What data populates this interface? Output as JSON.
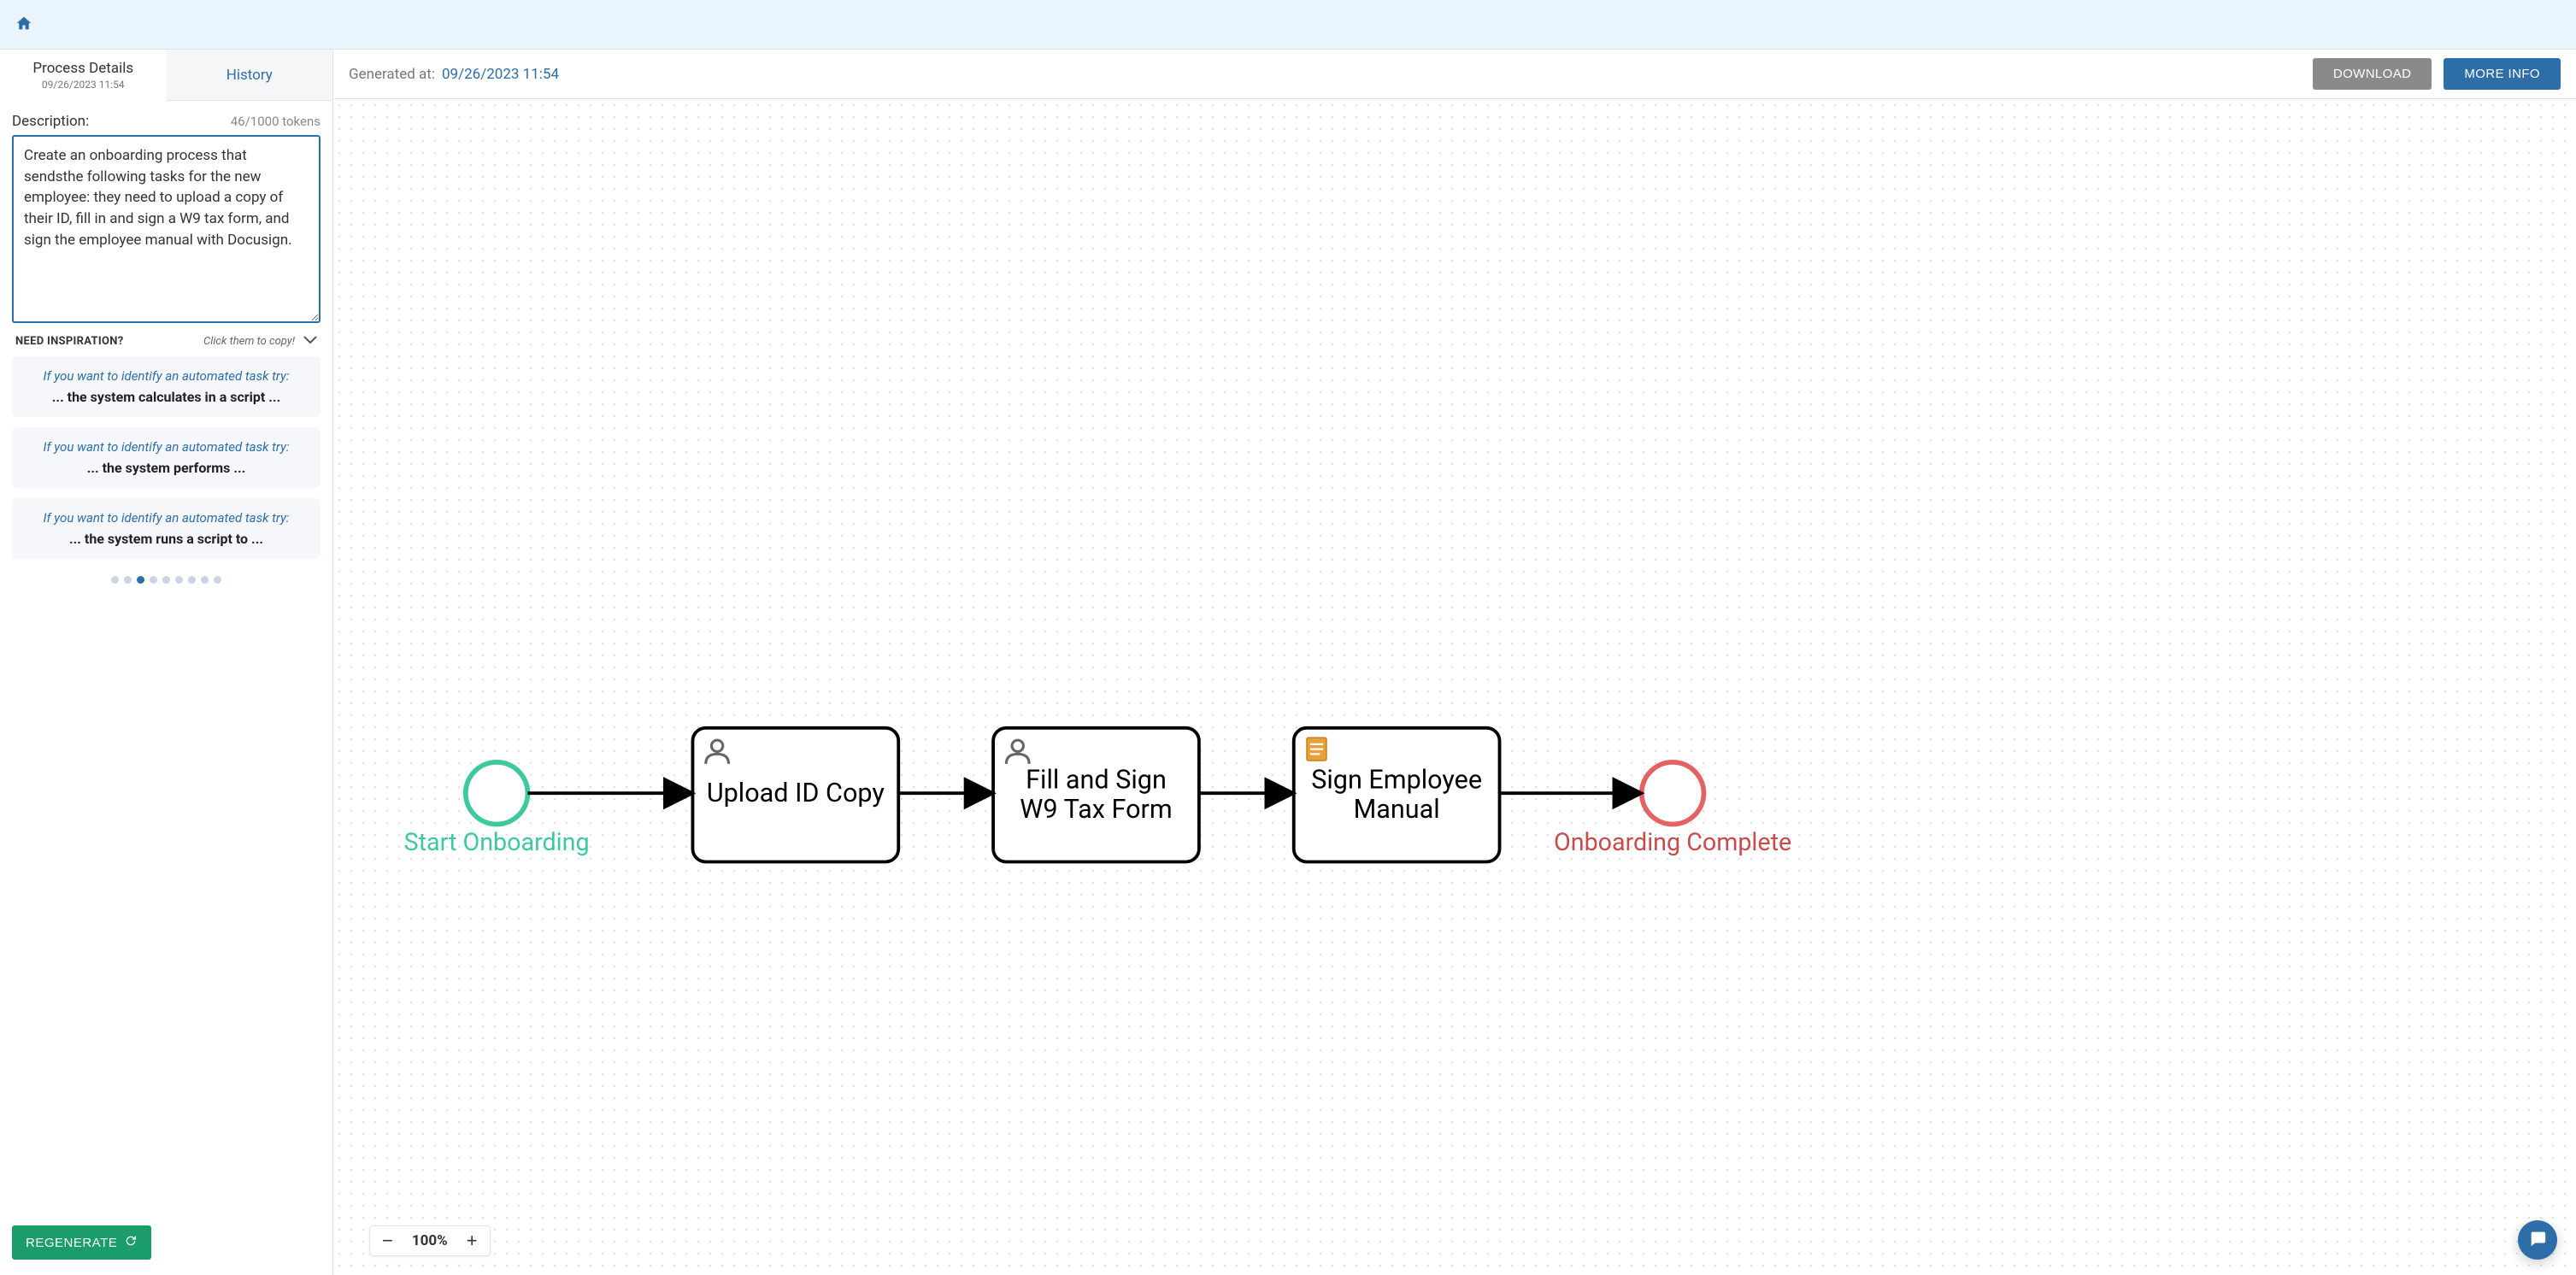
{
  "topbar": {
    "home_icon": "home-icon"
  },
  "tabs": {
    "details": {
      "title": "Process Details",
      "sub": "09/26/2023 11:54"
    },
    "history": {
      "title": "History"
    },
    "active_index": 0
  },
  "description": {
    "label": "Description:",
    "tokens": "46/1000 tokens",
    "value": "Create an onboarding process that sendsthe following tasks for the new employee: they need to upload a copy of their ID, fill in and sign a W9 tax form, and sign the employee manual with Docusign."
  },
  "inspiration": {
    "title": "NEED INSPIRATION?",
    "subtitle": "Click them to copy!",
    "cards": [
      {
        "lead": "If you want to identify an automated task try:",
        "main": "... the system calculates in a script ..."
      },
      {
        "lead": "If you want to identify an automated task try:",
        "main": "... the system performs ..."
      },
      {
        "lead": "If you want to identify an automated task try:",
        "main": "... the system runs a script to ..."
      }
    ],
    "dots_total": 9,
    "dots_active": 2
  },
  "regenerate_label": "REGENERATE",
  "rightHeader": {
    "generated_label": "Generated at:",
    "generated_value": "09/26/2023 11:54",
    "download_label": "DOWNLOAD",
    "moreinfo_label": "MORE INFO"
  },
  "zoom": {
    "level": "100%"
  },
  "diagram": {
    "start": {
      "label": "Start Onboarding"
    },
    "tasks": [
      {
        "id": "t1",
        "label": "Upload ID Copy",
        "icon": "user"
      },
      {
        "id": "t2",
        "label_line1": "Fill and Sign",
        "label_line2": "W9 Tax Form",
        "icon": "user"
      },
      {
        "id": "t3",
        "label_line1": "Sign Employee",
        "label_line2": "Manual",
        "icon": "document"
      }
    ],
    "end": {
      "label": "Onboarding Complete"
    }
  }
}
